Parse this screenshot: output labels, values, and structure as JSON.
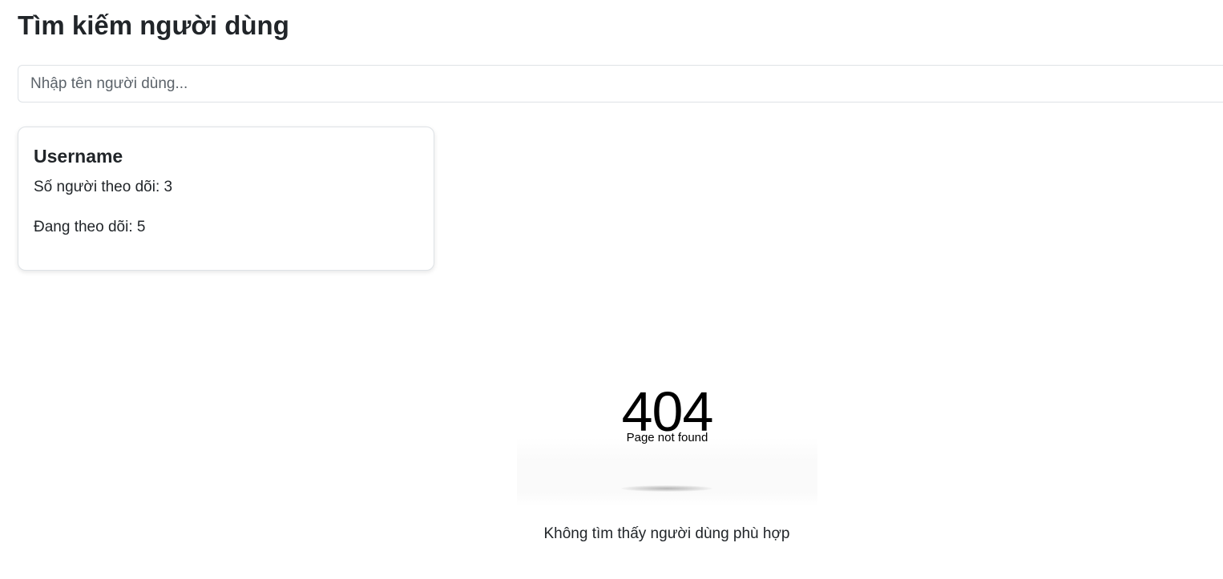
{
  "header": {
    "title": "Tìm kiếm người dùng"
  },
  "search": {
    "placeholder": "Nhập tên người dùng...",
    "value": ""
  },
  "user_card": {
    "username": "Username",
    "followers": "Số người theo dõi: 3",
    "following": "Đang theo dõi: 5"
  },
  "not_found": {
    "code": "404",
    "text": "Page not found",
    "message": "Không tìm thấy người dùng phù hợp"
  }
}
